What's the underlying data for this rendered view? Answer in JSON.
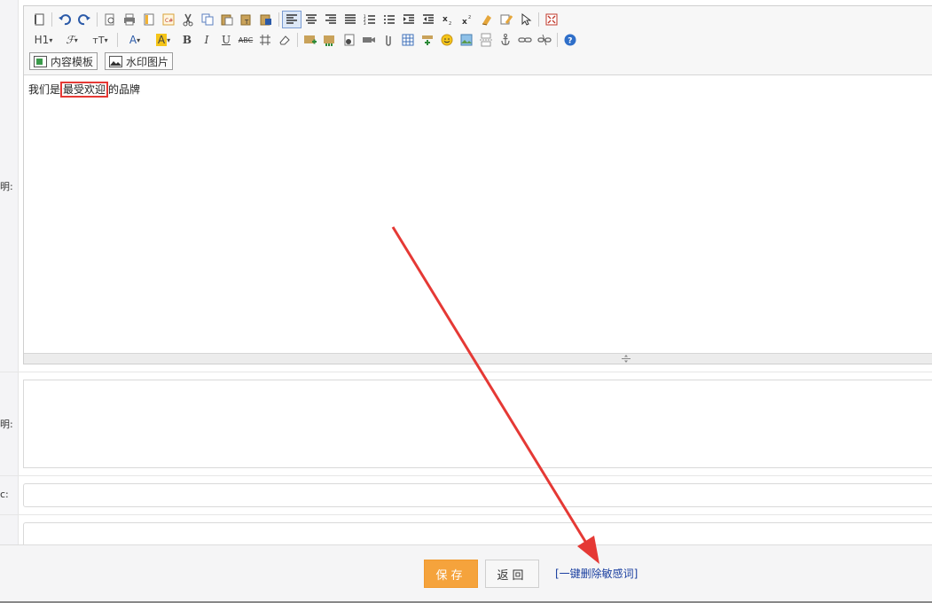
{
  "labels": {
    "editor": "明:",
    "keywords": "明:",
    "field_c": "c:"
  },
  "toolbar": {
    "heading_label": "H1",
    "template_button": "内容模板",
    "watermark_button": "水印图片"
  },
  "editor": {
    "text_before": "我们是",
    "text_highlight": "最受欢迎",
    "text_after": "的品牌"
  },
  "footer": {
    "save_label": "保存",
    "back_label": "返回",
    "delete_sensitive_link": "[一键删除敏感词]"
  },
  "colors": {
    "accent": "#f5a33c",
    "highlight_border": "#e53935",
    "arrow": "#e53935",
    "link": "#1a3fa0"
  }
}
